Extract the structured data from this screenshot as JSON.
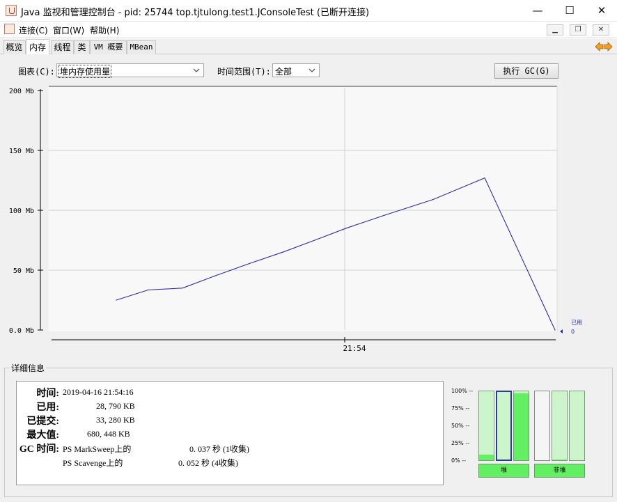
{
  "window": {
    "title": "Java 监视和管理控制台 - pid: 25744 top.tjtulong.test1.JConsoleTest (已断开连接)",
    "minimize": "—",
    "maximize": "☐",
    "close": "✕"
  },
  "menu": {
    "items": [
      "连接(C)",
      "窗口(W)",
      "帮助(H)"
    ],
    "mdi_minimize": "▁",
    "mdi_restore": "❐",
    "mdi_close": "✕"
  },
  "tabs": [
    "概览",
    "内存",
    "线程",
    "类",
    "VM 概要",
    "MBean"
  ],
  "selected_tab": "内存",
  "controls": {
    "chart_label": "图表(C):",
    "chart_value": "堆内存使用量",
    "range_label": "时间范围(T):",
    "range_value": "全部",
    "gc_button": "执行 GC(G)"
  },
  "chart_data": {
    "type": "line",
    "ylim": [
      0,
      200
    ],
    "y_ticks": [
      "0.0 Mb",
      "50 Mb",
      "100 Mb",
      "150 Mb",
      "200 Mb"
    ],
    "x_tick_label": "21:54",
    "series": [
      {
        "name": "已用",
        "color": "#2b2bb0",
        "values": [
          25,
          33.5,
          35,
          45.5,
          55.5,
          65,
          75,
          85,
          96,
          109,
          127,
          0
        ]
      }
    ],
    "legend_label": "已用",
    "legend_value": "0",
    "grid": true
  },
  "details": {
    "group_title": "详细信息",
    "labels": {
      "time": "时间:",
      "used": "已用:",
      "committed": "已提交:",
      "max": "最大值:",
      "gc": "GC 时间:"
    },
    "time": "2019-04-16 21:54:16",
    "used": "28, 790 KB",
    "committed": "33, 280 KB",
    "max": "680, 448 KB",
    "gc1_name": "PS MarkSweep上的",
    "gc1_value": "0. 037  秒 (1收集)",
    "gc2_name": "PS Scavenge上的",
    "gc2_value": "0. 052  秒 (4收集)"
  },
  "memory_bars": {
    "pct_labels": [
      "100% --",
      "75% --",
      "50% --",
      "25% --",
      "0% --"
    ],
    "heap_levels": [
      0.08,
      0.0,
      0.97
    ],
    "nonheap_levels": [
      0.0,
      0.01,
      0.0
    ],
    "heap_button": "堆",
    "nonheap_button": "非堆"
  }
}
